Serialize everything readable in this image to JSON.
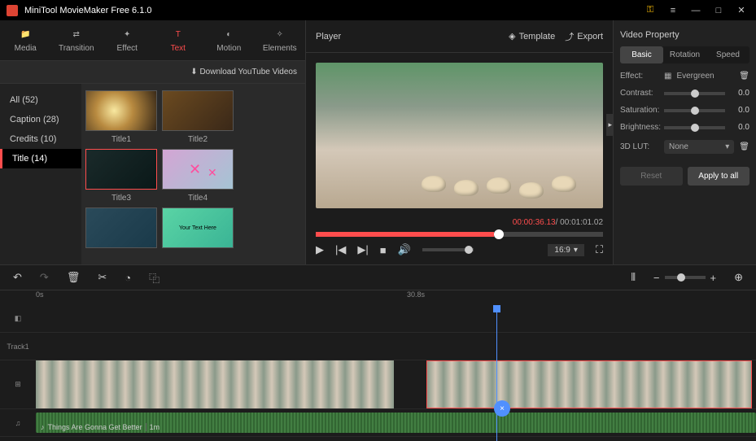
{
  "app": {
    "title": "MiniTool MovieMaker Free 6.1.0"
  },
  "tabs": [
    "Media",
    "Transition",
    "Effect",
    "Text",
    "Motion",
    "Elements"
  ],
  "dlLink": "Download YouTube Videos",
  "categories": [
    {
      "label": "All (52)"
    },
    {
      "label": "Caption (28)"
    },
    {
      "label": "Credits (10)"
    },
    {
      "label": "Title (14)",
      "active": true
    }
  ],
  "thumbs": [
    "Title1",
    "Title2",
    "Title3",
    "Title4",
    "",
    ""
  ],
  "bannerText": "Your Text Here",
  "player": {
    "title": "Player",
    "templateBtn": "Template",
    "exportBtn": "Export",
    "current": "00:00:36.13",
    "duration": "00:01:01.02",
    "aspect": "16:9"
  },
  "props": {
    "title": "Video Property",
    "tabs": [
      "Basic",
      "Rotation",
      "Speed"
    ],
    "effectLabel": "Effect:",
    "effectValue": "Evergreen",
    "rows": [
      {
        "label": "Contrast:",
        "value": "0.0"
      },
      {
        "label": "Saturation:",
        "value": "0.0"
      },
      {
        "label": "Brightness:",
        "value": "0.0"
      }
    ],
    "lutLabel": "3D LUT:",
    "lutValue": "None",
    "resetBtn": "Reset",
    "applyBtn": "Apply to all"
  },
  "ruler": {
    "start": "0s",
    "mid": "30.8s"
  },
  "track1": "Track1",
  "audioName": "Things Are Gonna Get Better",
  "audioDur": "1m"
}
